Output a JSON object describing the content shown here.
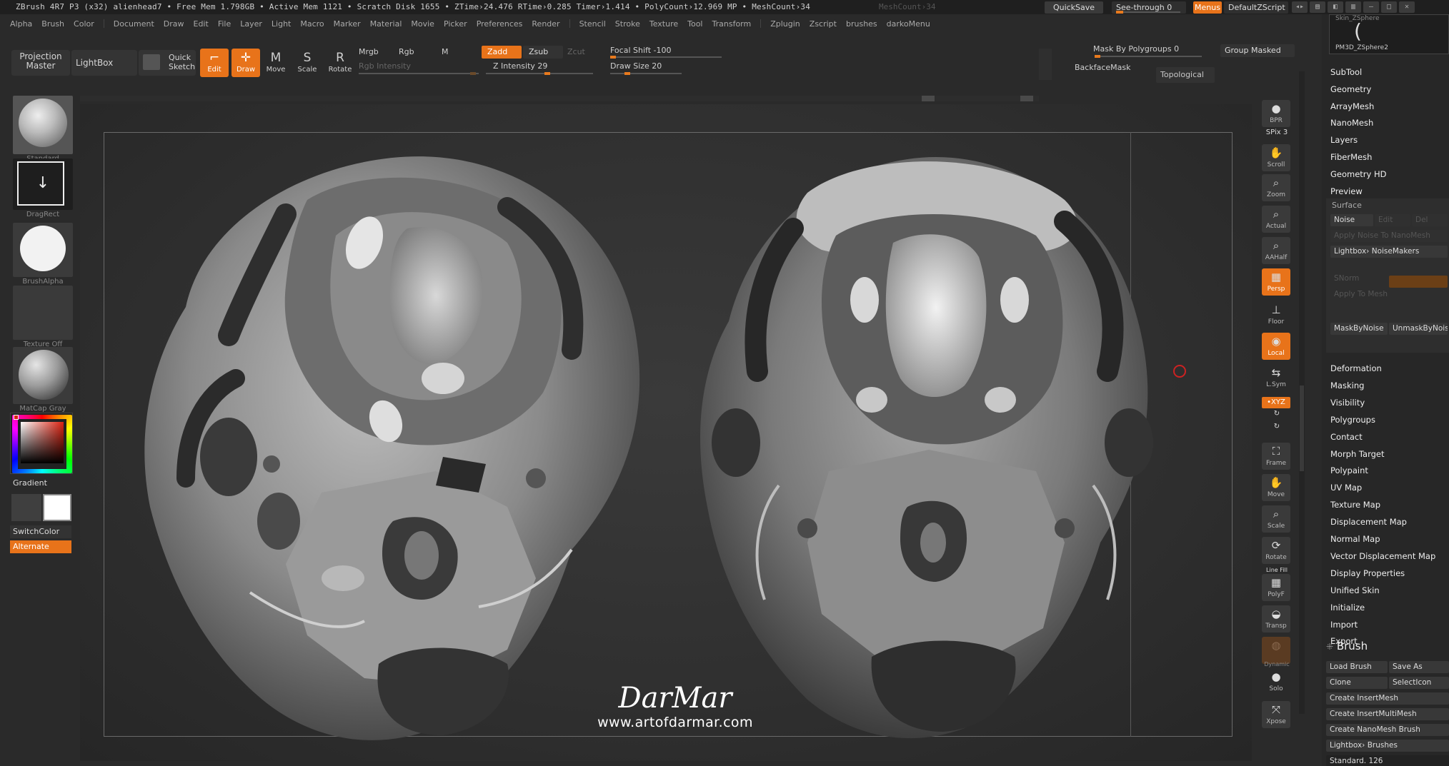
{
  "titlebar": {
    "text": "ZBrush 4R7 P3 (x32)    alienhead7    • Free Mem 1.798GB • Active Mem 1121 • Scratch Disk 1655 •  ZTime›24.476 RTime›0.285 Timer›1.414 • PolyCount›12.969 MP  • MeshCount›34",
    "ghost": "MeshCount›34",
    "quicksave": "QuickSave",
    "seethrough": "See-through   0",
    "menus": "Menus",
    "script": "DefaultZScript"
  },
  "menubar": {
    "items": [
      "Alpha",
      "Brush",
      "Color",
      "Document",
      "Draw",
      "Edit",
      "File",
      "Layer",
      "Light",
      "Macro",
      "Marker",
      "Material",
      "Movie",
      "Picker",
      "Preferences",
      "Render",
      "Stencil",
      "Stroke",
      "Texture",
      "Tool",
      "Transform",
      "Zplugin",
      "Zscript",
      "brushes",
      "darkoMenu"
    ]
  },
  "toolbar": {
    "projection_master": "Projection\nMaster",
    "lightbox": "LightBox",
    "quick_sketch": "Quick\nSketch",
    "edit": "Edit",
    "draw": "Draw",
    "move": "Move",
    "scale": "Scale",
    "rotate": "Rotate",
    "mrgb": "Mrgb",
    "rgb": "Rgb",
    "m": "M",
    "rgb_intensity": "Rgb Intensity",
    "zadd": "Zadd",
    "zsub": "Zsub",
    "zcut": "Zcut",
    "z_intensity": "Z Intensity 29",
    "focal_shift": "Focal Shift -100",
    "draw_size": "Draw Size 20",
    "mask_by_polygroups": "Mask By Polygroups 0",
    "group_masked": "Group Masked",
    "backface_mask": "BackfaceMask",
    "topological": "Topological"
  },
  "leftshelf": {
    "brush": "Standard",
    "stroke": "DragRect",
    "alpha": "BrushAlpha",
    "texture": "Texture Off",
    "material": "MatCap Gray",
    "gradient": "Gradient",
    "switch_color": "SwitchColor",
    "alternate": "Alternate"
  },
  "watermark": {
    "signature": "DarMar",
    "url": "www.artofdarmar.com"
  },
  "rightshelf": {
    "bpr": "BPR",
    "spix": "SPix 3",
    "scroll": "Scroll",
    "zoom": "Zoom",
    "actual": "Actual",
    "aahalf": "AAHalf",
    "persp": "Persp",
    "floor": "Floor",
    "local": "Local",
    "lsym": "L.Sym",
    "xyz": "•XYZ",
    "frame": "Frame",
    "move": "Move",
    "scale": "Scale",
    "rotate": "Rotate",
    "linefill": "Line Fill",
    "polyf": "PolyF",
    "transp": "Transp",
    "dynamic": "Dynamic",
    "solo": "Solo",
    "xpose": "Xpose"
  },
  "rpanel": {
    "top_caption": "Skin_ZSphere",
    "top_name": "PM3D_ZSphere2",
    "tool_items_a": [
      "SubTool",
      "Geometry",
      "ArrayMesh",
      "NanoMesh",
      "Layers",
      "FiberMesh",
      "Geometry HD",
      "Preview"
    ],
    "surface": {
      "header": "Surface",
      "noise": "Noise",
      "edit": "Edit",
      "del": "Del",
      "apply_nanomesh": "Apply Noise To NanoMesh",
      "lightbox_noisemakers": "Lightbox› NoiseMakers",
      "snorm": "SNorm",
      "apply_to_mesh": "Apply To Mesh",
      "mask_by_noise": "MaskByNoise",
      "unmask_by_noise": "UnmaskByNoise"
    },
    "tool_items_b": [
      "Deformation",
      "Masking",
      "Visibility",
      "Polygroups",
      "Contact",
      "Morph Target",
      "Polypaint",
      "UV Map",
      "Texture Map",
      "Displacement Map",
      "Normal Map",
      "Vector Displacement Map",
      "Display Properties",
      "Unified Skin",
      "Initialize",
      "Import",
      "Export"
    ],
    "brush_title": "Brush",
    "brush_buttons": {
      "load": "Load Brush",
      "save_as": "Save As",
      "clone": "Clone",
      "select_icon": "SelectIcon",
      "create_insert": "Create InsertMesh",
      "create_insert_multi": "Create InsertMultiMesh",
      "create_nano": "Create NanoMesh Brush",
      "lightbox_brushes": "Lightbox› Brushes",
      "standard": "Standard. 126"
    }
  }
}
